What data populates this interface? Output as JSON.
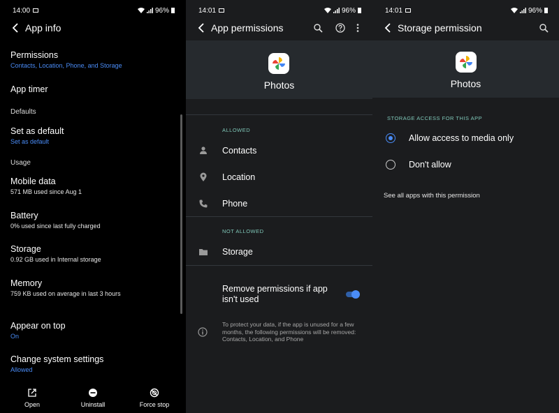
{
  "app_info": {
    "status_time": "14:00",
    "battery": "96%",
    "title": "App info",
    "permissions": {
      "label": "Permissions",
      "sub": "Contacts, Location, Phone, and Storage"
    },
    "app_timer": "App timer",
    "defaults_header": "Defaults",
    "set_default": {
      "label": "Set as default",
      "sub": "Set as default"
    },
    "usage_header": "Usage",
    "mobile_data": {
      "label": "Mobile data",
      "sub": "571 MB used since Aug 1"
    },
    "battery_item": {
      "label": "Battery",
      "sub": "0% used since last fully charged"
    },
    "storage": {
      "label": "Storage",
      "sub": "0.92 GB used in Internal storage"
    },
    "memory": {
      "label": "Memory",
      "sub": "759 KB used on average in last 3 hours"
    },
    "appear_on_top": {
      "label": "Appear on top",
      "sub": "On"
    },
    "change_system": {
      "label": "Change system settings",
      "sub": "Allowed"
    },
    "bottom": {
      "open": "Open",
      "uninstall": "Uninstall",
      "force_stop": "Force stop"
    }
  },
  "app_permissions": {
    "status_time": "14:01",
    "battery": "96%",
    "title": "App permissions",
    "app_name": "Photos",
    "allowed_header": "ALLOWED",
    "allowed": [
      "Contacts",
      "Location",
      "Phone"
    ],
    "not_allowed_header": "NOT ALLOWED",
    "not_allowed": [
      "Storage"
    ],
    "remove_toggle_label": "Remove permissions if app isn't used",
    "remove_toggle_on": true,
    "info_text": "To protect your data, if the app is unused for a few months, the following permissions will be removed: Contacts, Location, and Phone"
  },
  "storage_permission": {
    "status_time": "14:01",
    "battery": "96%",
    "title": "Storage permission",
    "app_name": "Photos",
    "section_header": "STORAGE ACCESS FOR THIS APP",
    "options": [
      "Allow access to media only",
      "Don't allow"
    ],
    "selected_index": 0,
    "see_all": "See all apps with this permission"
  },
  "colors": {
    "accent": "#4a8cf7",
    "section_teal": "#7fc7b8"
  }
}
